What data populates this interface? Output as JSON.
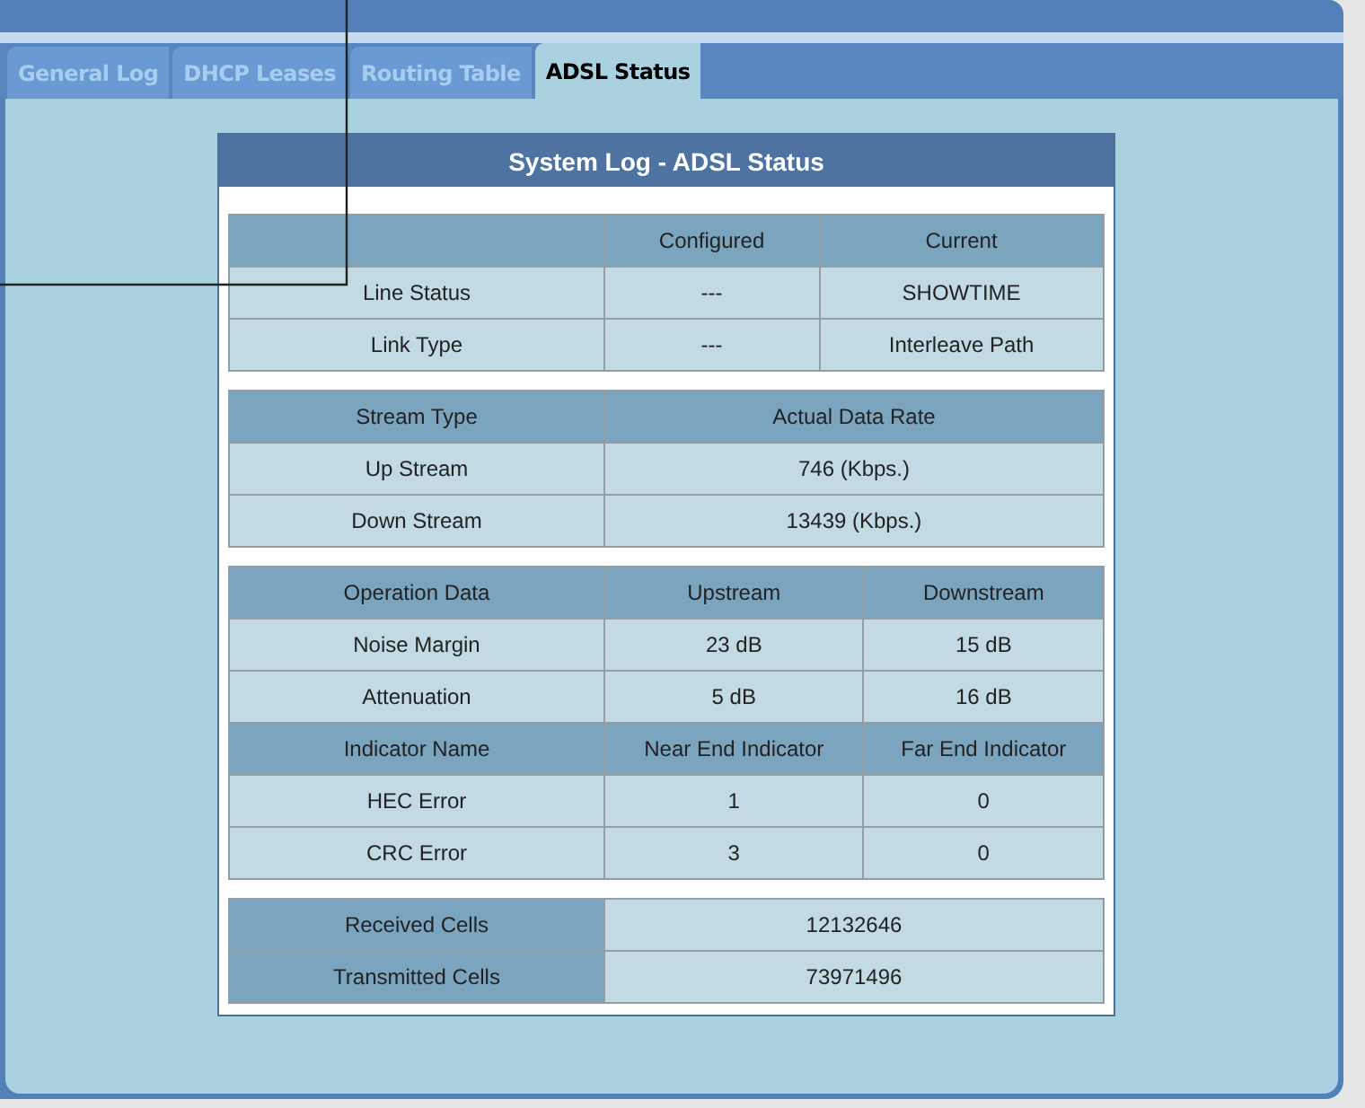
{
  "tabs": [
    {
      "label": "General Log",
      "selected": false
    },
    {
      "label": "DHCP Leases",
      "selected": false
    },
    {
      "label": "Routing Table",
      "selected": false
    },
    {
      "label": "ADSL Status",
      "selected": true
    }
  ],
  "panel": {
    "title": "System Log - ADSL Status"
  },
  "sections": [
    {
      "rows": [
        {
          "kind": "header",
          "cells": [
            "",
            "Configured",
            "Current"
          ]
        },
        {
          "kind": "data",
          "cells": [
            "Line Status",
            "---",
            "SHOWTIME"
          ]
        },
        {
          "kind": "data",
          "cells": [
            "Link Type",
            "---",
            "Interleave Path"
          ]
        }
      ]
    },
    {
      "rows": [
        {
          "kind": "header",
          "cells": [
            "Stream Type",
            "Actual Data Rate"
          ]
        },
        {
          "kind": "data",
          "cells": [
            "Up Stream",
            "746 (Kbps.)"
          ]
        },
        {
          "kind": "data",
          "cells": [
            "Down Stream",
            "13439 (Kbps.)"
          ]
        }
      ]
    },
    {
      "rows": [
        {
          "kind": "header",
          "cells": [
            "Operation Data",
            "Upstream",
            "Downstream"
          ]
        },
        {
          "kind": "data",
          "cells": [
            "Noise Margin",
            "23 dB",
            "15 dB"
          ]
        },
        {
          "kind": "data",
          "cells": [
            "Attenuation",
            "5 dB",
            "16 dB"
          ]
        },
        {
          "kind": "header",
          "cells": [
            "Indicator Name",
            "Near End Indicator",
            "Far End Indicator"
          ]
        },
        {
          "kind": "data",
          "cells": [
            "HEC Error",
            "1",
            "0"
          ]
        },
        {
          "kind": "data",
          "cells": [
            "CRC Error",
            "3",
            "0"
          ]
        }
      ]
    },
    {
      "rows": [
        {
          "kind": "labeled",
          "cells": [
            "Received Cells",
            "12132646"
          ]
        },
        {
          "kind": "labeled",
          "cells": [
            "Transmitted Cells",
            "73971496"
          ]
        }
      ]
    }
  ]
}
